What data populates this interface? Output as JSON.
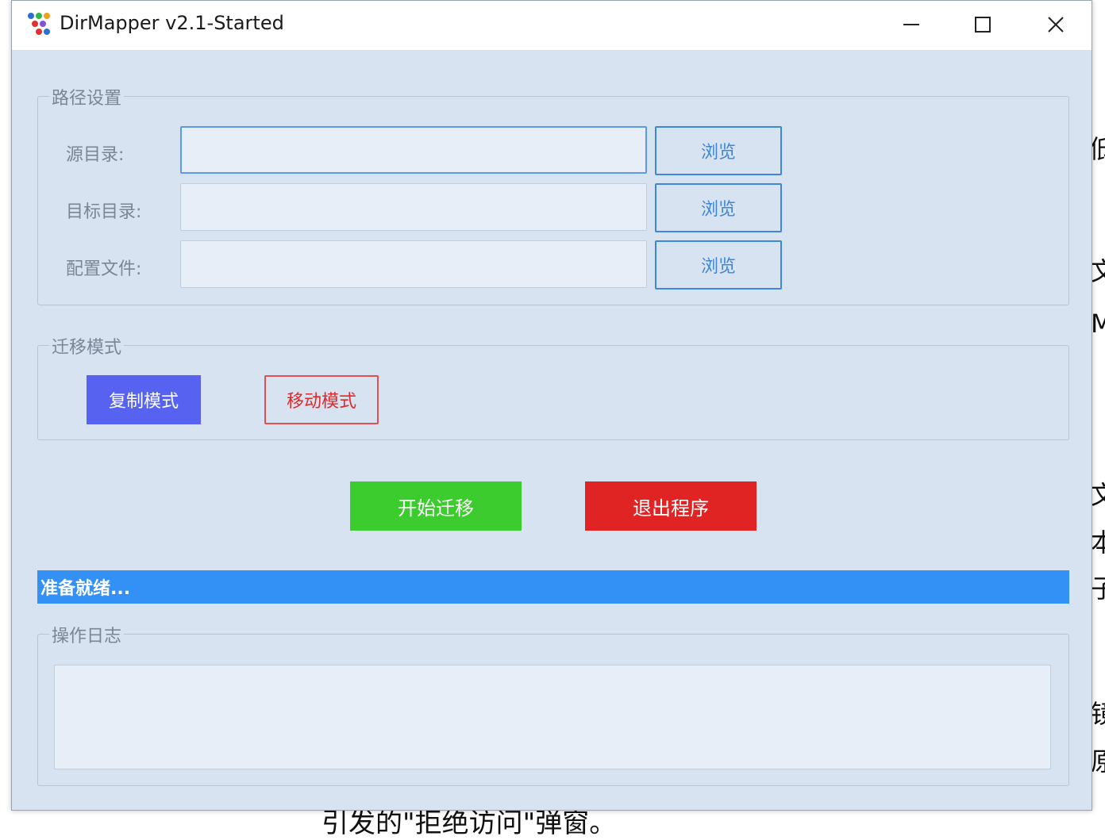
{
  "window": {
    "title": "DirMapper v2.1-Started",
    "icon": "app-dots-icon"
  },
  "path_settings": {
    "legend": "路径设置",
    "fields": [
      {
        "label": "源目录:",
        "value": "",
        "browse_label": "浏览"
      },
      {
        "label": "目标目录:",
        "value": "",
        "browse_label": "浏览"
      },
      {
        "label": "配置文件:",
        "value": "",
        "browse_label": "浏览"
      }
    ]
  },
  "migration_mode": {
    "legend": "迁移模式",
    "copy_label": "复制模式",
    "move_label": "移动模式"
  },
  "actions": {
    "start_label": "开始迁移",
    "exit_label": "退出程序"
  },
  "status": {
    "text": "准备就绪..."
  },
  "log": {
    "legend": "操作日志",
    "content": ""
  },
  "background_text": {
    "bottom": "引发的\"拒绝访问\"弹窗。",
    "side": [
      "低",
      "文",
      "M",
      "文",
      "本",
      "子",
      "镜",
      "原"
    ]
  },
  "colors": {
    "window_bg": "#d8e3f1",
    "copy_mode": "#5763f0",
    "move_mode_border": "#e05050",
    "start": "#3dcc2e",
    "exit": "#e02424",
    "status_bar": "#3390f5",
    "browse_border": "#3e86d9"
  }
}
